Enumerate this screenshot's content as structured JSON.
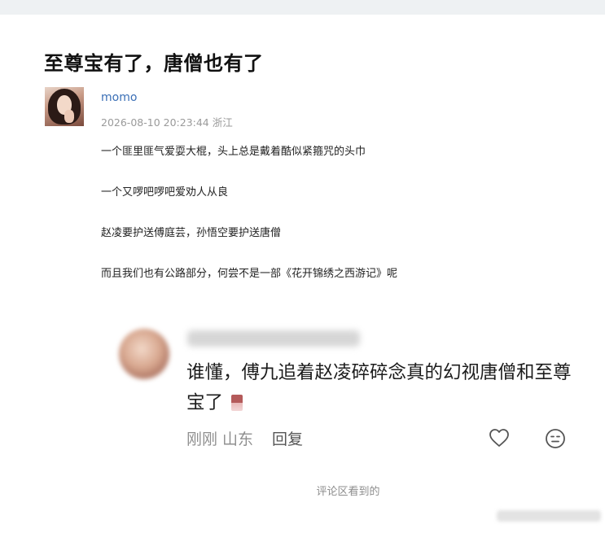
{
  "post": {
    "title": "至尊宝有了，唐僧也有了",
    "author": "momo",
    "meta": "2026-08-10 20:23:44 浙江",
    "paragraphs": [
      "一个匪里匪气爱耍大棍，头上总是戴着酷似紧箍咒的头巾",
      "一个又啰吧啰吧爱劝人从良",
      "赵凌要护送傅庭芸，孙悟空要护送唐僧",
      "而且我们也有公路部分，何尝不是一部《花开锦绣之西游记》呢"
    ]
  },
  "comment": {
    "text": "谁懂，傅九追着赵凌碎碎念真的幻视唐僧和至尊宝了",
    "time_location": "刚刚 山东",
    "reply_label": "回复",
    "icons": [
      "heart-icon",
      "smile-icon"
    ]
  },
  "footer": {
    "note": "评论区看到的"
  }
}
